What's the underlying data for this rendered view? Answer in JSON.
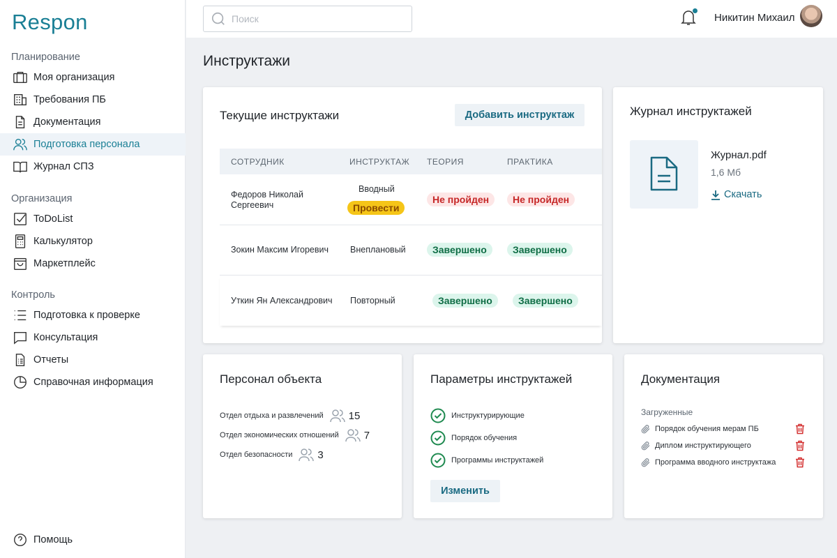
{
  "logo": "Respon",
  "sidebar": {
    "sections": [
      "Планирование",
      "Организация",
      "Контроль"
    ],
    "items": [
      {
        "label": "Моя организация"
      },
      {
        "label": "Требования ПБ"
      },
      {
        "label": "Документация"
      },
      {
        "label": "Подготовка персонала"
      },
      {
        "label": "Журнал СПЗ"
      },
      {
        "label": "ToDoList"
      },
      {
        "label": "Калькулятор"
      },
      {
        "label": "Маркетплейс"
      },
      {
        "label": "Подготовка к проверке"
      },
      {
        "label": "Консультация"
      },
      {
        "label": "Отчеты"
      },
      {
        "label": "Справочная информация"
      }
    ],
    "help": "Помощь",
    "active_color": "#1a7f95"
  },
  "header": {
    "search_placeholder": "Поиск",
    "user_name": "Никитин Михаил"
  },
  "page_title": "Инструктажи",
  "current": {
    "title": "Текущие инструктажи",
    "add_button": "Добавить инструктаж",
    "columns": [
      "СОТРУДНИК",
      "ИНСТРУКТАЖ",
      "ТЕОРИЯ",
      "ПРАКТИКА"
    ],
    "rows": [
      {
        "employee_line1": "Федоров Николай",
        "employee_line2": "Сергеевич",
        "type": "Вводный",
        "action": "Провести",
        "theory": "Не  пройден",
        "practice": "Не  пройден"
      },
      {
        "employee_line1": "Зокин Максим Игоревич",
        "employee_line2": "",
        "type": "Внеплановый",
        "action": "",
        "theory": "Завершено",
        "practice": "Завершено"
      },
      {
        "employee_line1": "Уткин Ян Александрович",
        "employee_line2": "",
        "type": "Повторный",
        "action": "",
        "theory": "Завершено",
        "practice": "Завершено"
      }
    ]
  },
  "journal": {
    "title": "Журнал инструктажей",
    "file_name": "Журнал.pdf",
    "file_size": "1,6 Мб",
    "download": "Скачать"
  },
  "staff": {
    "title": "Персонал объекта",
    "departments": [
      {
        "name": "Отдел отдыха и развлечений",
        "count": "15"
      },
      {
        "name": "Отдел экономических отношений",
        "count": "7"
      },
      {
        "name": "Отдел безопасности",
        "count": "3"
      }
    ]
  },
  "params": {
    "title": "Параметры инструктажей",
    "items": [
      "Инструктурирующие",
      "Порядок обучения",
      "Программы инструктажей"
    ],
    "edit_button": "Изменить"
  },
  "docs": {
    "title": "Документация",
    "subtitle": "Загруженные",
    "items": [
      "Порядок обучения мерам ПБ",
      "Диплом инструктирующего",
      "Программа вводного инструктажа"
    ]
  },
  "colors": {
    "accent": "#1a7f95",
    "success": "#0f6d45",
    "danger": "#c62828",
    "warning": "#f5c518"
  }
}
